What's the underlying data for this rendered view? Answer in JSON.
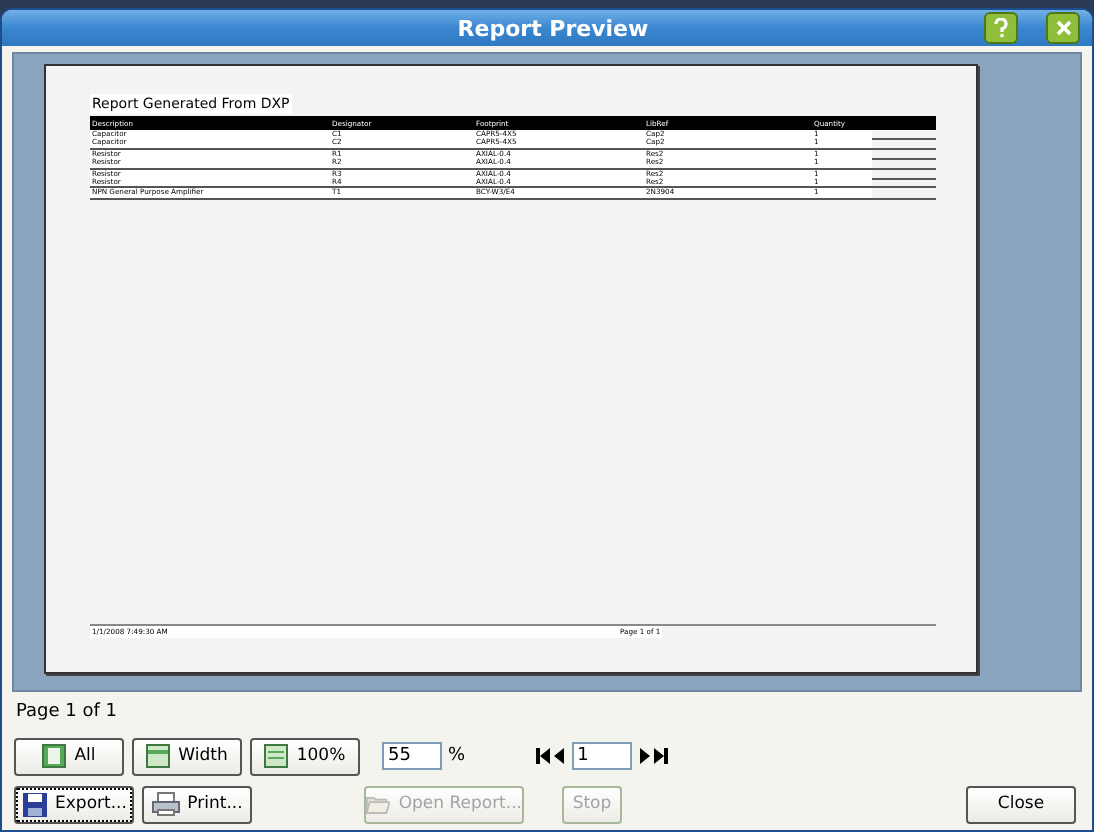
{
  "window": {
    "title": "Report Preview"
  },
  "report": {
    "title": "Report Generated From DXP",
    "columns": [
      "Description",
      "Designator",
      "Footprint",
      "LibRef",
      "Quantity"
    ],
    "rows": [
      [
        "Capacitor",
        "C1",
        "CAPR5-4X5",
        "Cap2",
        "1"
      ],
      [
        "Capacitor",
        "C2",
        "CAPR5-4X5",
        "Cap2",
        "1"
      ],
      [
        "Resistor",
        "R1",
        "AXIAL-0.4",
        "Res2",
        "1"
      ],
      [
        "Resistor",
        "R2",
        "AXIAL-0.4",
        "Res2",
        "1"
      ],
      [
        "Resistor",
        "R3",
        "AXIAL-0.4",
        "Res2",
        "1"
      ],
      [
        "Resistor",
        "R4",
        "AXIAL-0.4",
        "Res2",
        "1"
      ],
      [
        "NPN General Purpose Amplifier",
        "T1",
        "BCY-W3/E4",
        "2N3904",
        "1"
      ]
    ],
    "footer_date": "1/1/2008 7:49:30 AM",
    "footer_page": "Page 1 of 1"
  },
  "status": "Page 1 of 1",
  "zoom_buttons": [
    {
      "label": "All",
      "kind": "page"
    },
    {
      "label": "Width",
      "kind": "width"
    },
    {
      "label": "100%",
      "kind": "full"
    }
  ],
  "zoom_field": {
    "value": "55",
    "unit": "%"
  },
  "page_field": {
    "value": "1"
  },
  "buttons": [
    {
      "label": "Export...",
      "kind": "save",
      "disabled": false,
      "focused": true
    },
    {
      "label": "Print...",
      "kind": "print",
      "disabled": false,
      "focused": false
    },
    {
      "label": "Open Report...",
      "kind": "open",
      "disabled": true,
      "focused": false
    },
    {
      "label": "Stop",
      "kind": "none",
      "disabled": true,
      "focused": false
    },
    {
      "label": "Close",
      "kind": "none",
      "disabled": false,
      "focused": false
    }
  ]
}
